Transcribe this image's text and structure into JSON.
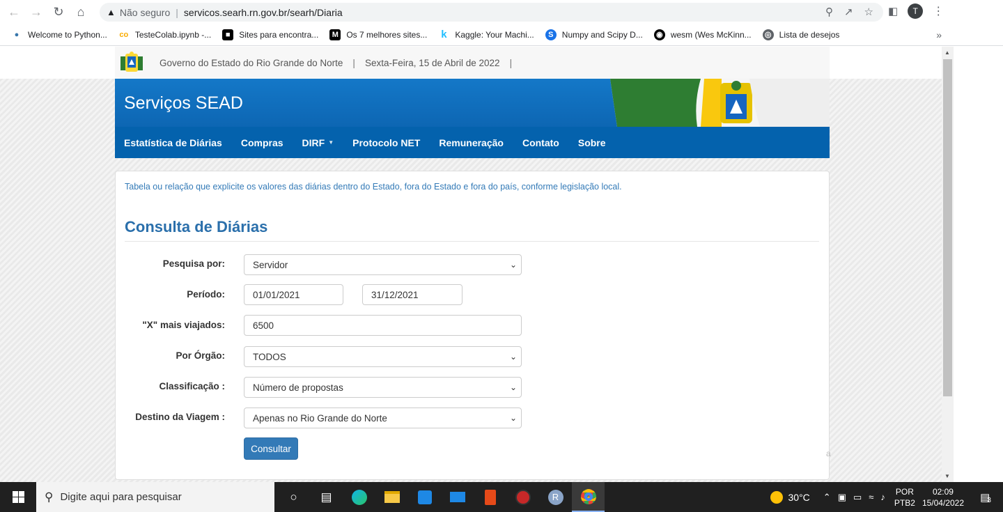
{
  "browser": {
    "not_secure_label": "Não seguro",
    "url": "servicos.searh.rn.gov.br/searh/Diaria",
    "avatar_letter": "T",
    "bookmarks": [
      {
        "label": "Welcome to Python...",
        "icon": "python-icon",
        "color": "#3776ab"
      },
      {
        "label": "TesteColab.ipynb -...",
        "icon": "colab-icon",
        "color": "#f9ab00"
      },
      {
        "label": "Sites para encontra...",
        "icon": "media-icon",
        "color": "#000000"
      },
      {
        "label": "Os 7 melhores sites...",
        "icon": "medium-icon",
        "color": "#000000"
      },
      {
        "label": "Kaggle: Your Machi...",
        "icon": "kaggle-icon",
        "color": "#20beff"
      },
      {
        "label": "Numpy and Scipy D...",
        "icon": "scipy-icon",
        "color": "#1a73e8"
      },
      {
        "label": "wesm (Wes McKinn...",
        "icon": "github-icon",
        "color": "#000000"
      },
      {
        "label": "Lista de desejos",
        "icon": "globe-icon",
        "color": "#5f6368"
      }
    ],
    "bookmarks_more": "»"
  },
  "header": {
    "gov_name": "Governo do Estado do Rio Grande do Norte",
    "date": "Sexta-Feira, 15 de Abril de 2022",
    "site_title": "Serviços SEAD"
  },
  "menu": {
    "items": [
      "Estatística de Diárias",
      "Compras",
      "DIRF",
      "Protocolo NET",
      "Remuneração",
      "Contato",
      "Sobre"
    ]
  },
  "content": {
    "intro": "Tabela ou relação que explicite os valores das diárias dentro do Estado, fora do Estado e fora do país, conforme legislação local.",
    "heading": "Consulta de Diárias",
    "form": {
      "search_by_label": "Pesquisa por:",
      "search_by_value": "Servidor",
      "period_label": "Período:",
      "period_start": "01/01/2021",
      "period_end": "31/12/2021",
      "top_travelers_label": "\"X\" mais viajados:",
      "top_travelers_value": "6500",
      "organ_label": "Por Órgão:",
      "organ_value": "TODOS",
      "classification_label": "Classificação :",
      "classification_value": "Número de propostas",
      "destination_label": "Destino da Viagem :",
      "destination_value": "Apenas no Rio Grande do Norte",
      "submit_label": "Consultar"
    },
    "stray_char": "a"
  },
  "taskbar": {
    "search_placeholder": "Digite aqui para pesquisar",
    "temperature": "30°C",
    "lang_line1": "POR",
    "lang_line2": "PTB2",
    "time": "02:09",
    "date": "15/04/2022",
    "notification_count": "3"
  },
  "colors": {
    "banner_blue": "#1478c8",
    "menu_blue": "#0462ad",
    "link_blue": "#337ab7",
    "button_blue": "#337ab7",
    "taskbar": "#202020"
  }
}
